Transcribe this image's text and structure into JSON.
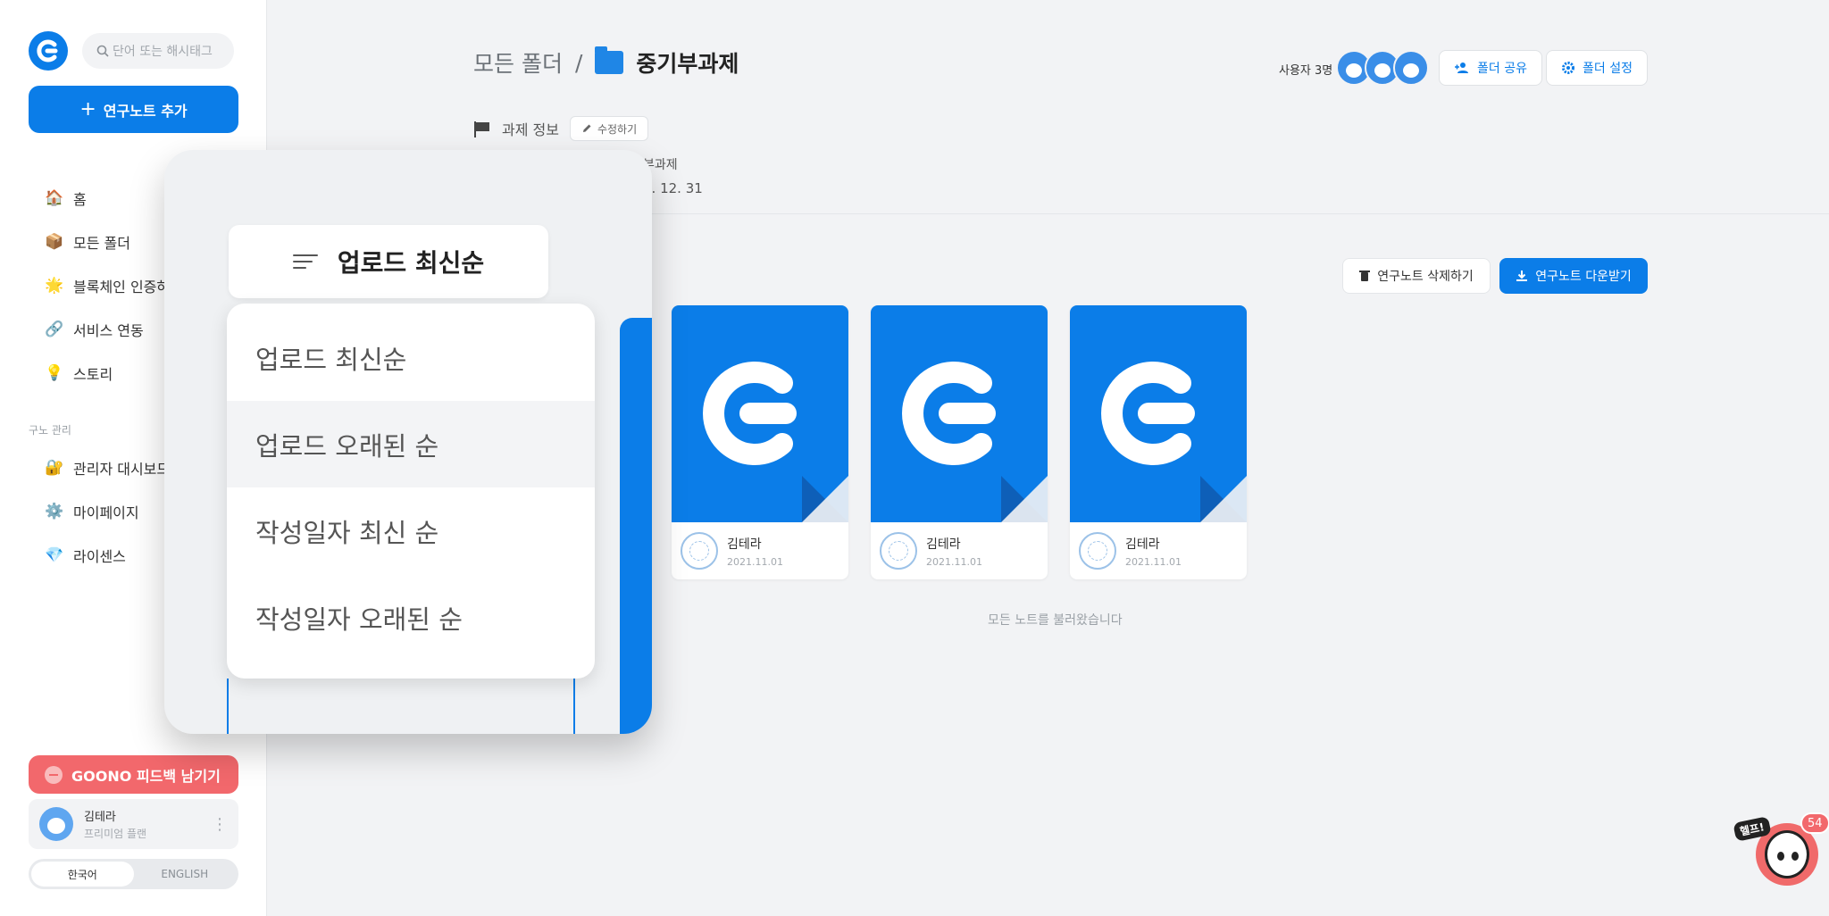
{
  "sidebar": {
    "search": {
      "placeholder": "단어 또는 해시태그"
    },
    "add_note_label": "연구노트 추가",
    "nav": [
      {
        "icon": "🏠",
        "label": "홈"
      },
      {
        "icon": "📦",
        "label": "모든 폴더"
      },
      {
        "icon": "🌟",
        "label": "블록체인 인증하"
      },
      {
        "icon": "🔗",
        "label": "서비스 연동"
      },
      {
        "icon": "💡",
        "label": "스토리"
      }
    ],
    "section_label": "구노 관리",
    "admin_nav": [
      {
        "icon": "🔐",
        "label": "관리자 대시보드"
      },
      {
        "icon": "⚙️",
        "label": "마이페이지"
      },
      {
        "icon": "💎",
        "label": "라이센스"
      }
    ],
    "feedback_label": "GOONO 피드백 남기기",
    "user": {
      "name": "김테라",
      "plan": "프리미엄 플랜"
    },
    "languages": [
      "한국어",
      "ENGLISH"
    ],
    "active_language": "한국어"
  },
  "header": {
    "breadcrumb_root": "모든 폴더",
    "separator": "/",
    "folder_name": "중기부과제",
    "info_label": "과제 정보",
    "edit_label": "수정하기",
    "task_name_fragment": "부과제",
    "task_date_fragment": "1. 12. 31",
    "users_label": "사용자 3명",
    "share_label": "폴더 공유",
    "settings_label": "폴더 설정"
  },
  "toolbar": {
    "delete_label": "연구노트 삭제하기",
    "download_label": "연구노트 다운받기"
  },
  "sort": {
    "selected": "업로드 최신순",
    "options": [
      "업로드 최신순",
      "업로드 오래된 순",
      "작성일자 최신 순",
      "작성일자 오래된 순"
    ],
    "hovered": "업로드 오래된 순"
  },
  "notes": [
    {
      "author": "김테라",
      "date": "2021.11.01"
    },
    {
      "author": "김테라",
      "date": "2021.11.01"
    },
    {
      "author": "김테라",
      "date": "2021.11.01"
    }
  ],
  "all_loaded_text": "모든 노트를 불러왔습니다",
  "help": {
    "tag": "헬프!",
    "badge": "54"
  },
  "colors": {
    "primary": "#0b7de8",
    "feedback": "#f2686c",
    "background": "#f2f3f5"
  }
}
